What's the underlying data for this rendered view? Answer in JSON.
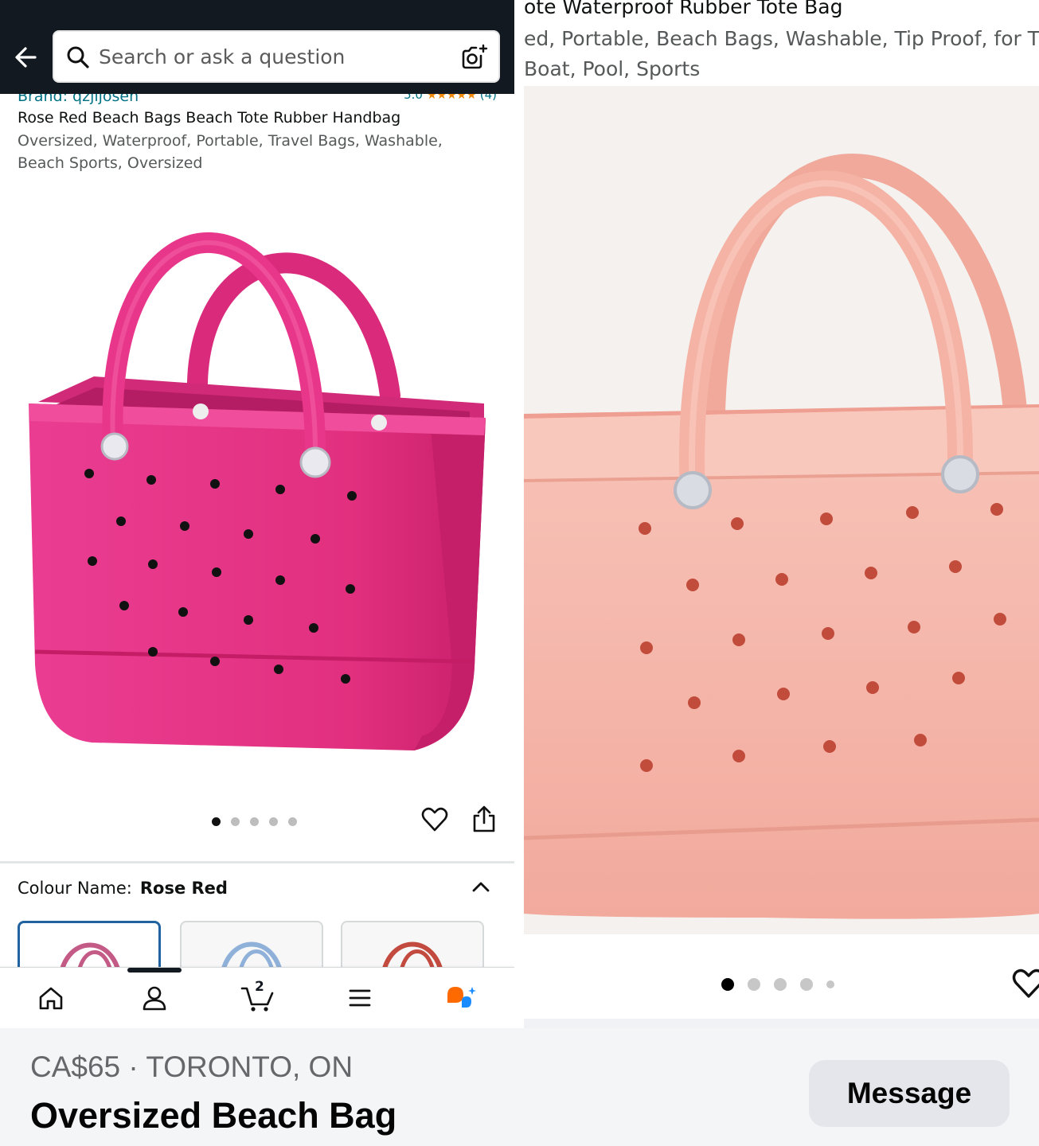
{
  "amazon": {
    "search_placeholder": "Search or ask a question",
    "brand_label": "Brand: qzjijosen",
    "rating_value": "5.0",
    "rating_stars": "★★★★★",
    "rating_count": "(4)",
    "product_title": "Rose Red Beach Bags Beach Tote Rubber Handbag",
    "product_desc": "Oversized, Waterproof, Portable, Travel Bags, Washable, Beach Sports, Oversized",
    "colour_label": "Colour Name:",
    "colour_value": "Rose Red",
    "carousel_total": 5,
    "carousel_active": 1,
    "cart_count": "2",
    "nav_icons": [
      "home-icon",
      "account-icon",
      "cart-icon",
      "menu-icon",
      "rufus-icon"
    ],
    "swatch_colors": [
      "#c45a86",
      "#8fb0d8",
      "#c24a3e"
    ],
    "bag_color": "#e8328a"
  },
  "listing_image": {
    "title_fragment": "ote Waterproof Rubber Tote Bag",
    "desc_line1": "ed, Portable, Beach Bags, Washable, Tip Proof, for The",
    "desc_line2": "Boat, Pool, Sports",
    "carousel_total": 5,
    "carousel_active": 1,
    "bag_color": "#f6b6ab"
  },
  "marketplace": {
    "price_location": "CA$65 · TORONTO, ON",
    "listing_title": "Oversized Beach Bag",
    "message_label": "Message"
  }
}
